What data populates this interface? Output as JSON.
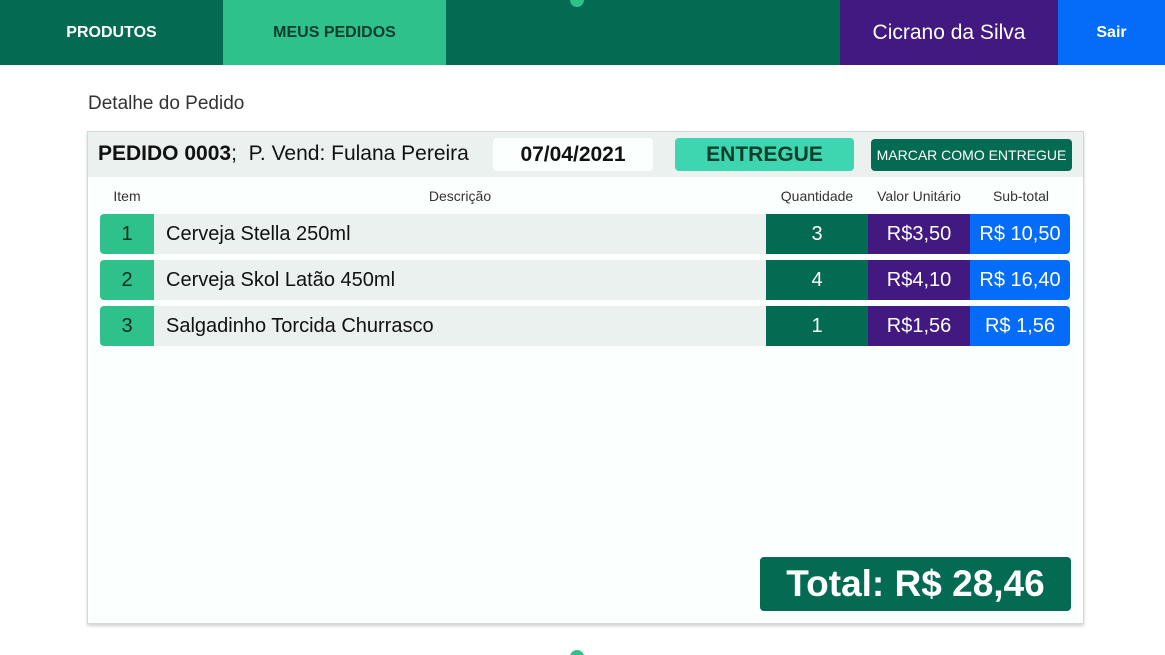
{
  "navbar": {
    "products_label": "PRODUTOS",
    "orders_label": "MEUS PEDIDOS",
    "user_name": "Cicrano da Silva",
    "logout_label": "Sair"
  },
  "page": {
    "title": "Detalhe do Pedido"
  },
  "order": {
    "number": "PEDIDO 0003",
    "separator": ";",
    "seller": "P. Vend: Fulana Pereira",
    "date": "07/04/2021",
    "status": "ENTREGUE",
    "mark_delivered_label": "MARCAR COMO ENTREGUE",
    "total": "Total: R$ 28,46"
  },
  "table": {
    "headers": {
      "item": "Item",
      "description": "Descrição",
      "quantity": "Quantidade",
      "unit_price": "Valor Unitário",
      "subtotal": "Sub-total"
    },
    "rows": [
      {
        "item": "1",
        "description": "Cerveja Stella 250ml",
        "quantity": "3",
        "unit_price": "R$3,50",
        "subtotal": "R$ 10,50"
      },
      {
        "item": "2",
        "description": "Cerveja Skol Latão 450ml",
        "quantity": "4",
        "unit_price": "R$4,10",
        "subtotal": "R$ 16,40"
      },
      {
        "item": "3",
        "description": "Salgadinho Torcida Churrasco",
        "quantity": "1",
        "unit_price": "R$1,56",
        "subtotal": "R$ 1,56"
      }
    ]
  },
  "colors": {
    "primary_green": "#036b52",
    "light_green": "#2fc18c",
    "status_green": "#3ed6b0",
    "purple": "#421981",
    "blue": "#056cf9"
  }
}
